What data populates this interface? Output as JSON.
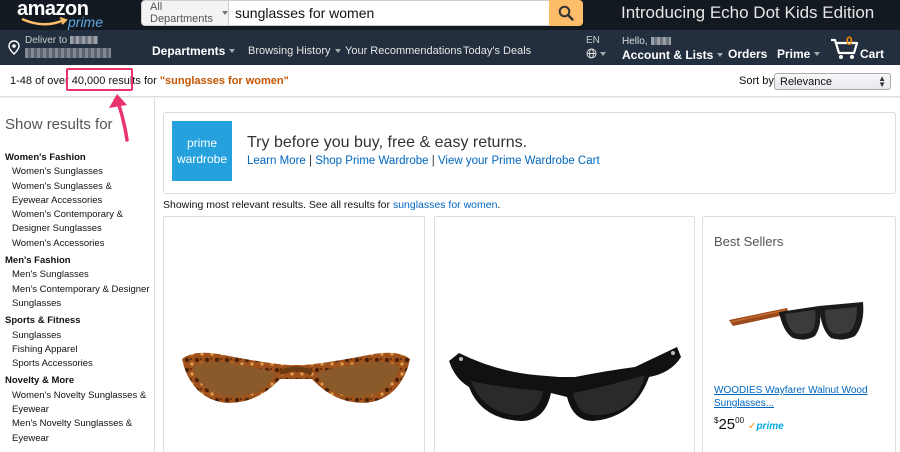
{
  "colors": {
    "nav_top": "#131921",
    "nav_bottom": "#232f3e",
    "search_button": "#febd69",
    "link": "#0066c0",
    "query": "#c45500",
    "annotation": "#e8336d",
    "prime_wardrobe": "#25a2de"
  },
  "header": {
    "logo_text": "amazon",
    "logo_sub": "prime",
    "search": {
      "department": "All Departments",
      "query": "sunglasses for women",
      "button_icon": "search-icon"
    },
    "promo": "Introducing Echo Dot Kids Edition",
    "deliver_label": "Deliver to",
    "nav_links": {
      "departments": "Departments",
      "browsing_history": "Browsing History",
      "recommendations": "Your Recommendations",
      "deals": "Today's Deals"
    },
    "language": "EN",
    "account_hello": "Hello,",
    "account": "Account & Lists",
    "orders": "Orders",
    "prime": "Prime",
    "cart_count": "0",
    "cart": "Cart"
  },
  "results": {
    "prefix": "1-48 of over",
    "count": "40,000 results",
    "for": "for",
    "query": "\"sunglasses for women\"",
    "sort_label": "Sort by",
    "sort_value": "Relevance"
  },
  "sidebar": {
    "title": "Show results for",
    "categories": [
      {
        "name": "Women's Fashion",
        "items": [
          "Women's Sunglasses",
          "Women's Sunglasses & Eyewear Accessories",
          "Women's Contemporary & Designer Sunglasses",
          "Women's Accessories"
        ]
      },
      {
        "name": "Men's Fashion",
        "items": [
          "Men's Sunglasses",
          "Men's Contemporary & Designer Sunglasses"
        ]
      },
      {
        "name": "Sports & Fitness",
        "items": [
          "Sunglasses",
          "Fishing Apparel",
          "Sports Accessories"
        ]
      },
      {
        "name": "Novelty & More",
        "items": [
          "Women's Novelty Sunglasses & Eyewear",
          "Men's Novelty Sunglasses & Eyewear"
        ]
      }
    ]
  },
  "wardrobe": {
    "logo_line1": "prime",
    "logo_line2": "wardrobe",
    "title": "Try before you buy, free & easy returns.",
    "link1": "Learn More",
    "link2": "Shop Prime Wardrobe",
    "link3": "View your Prime Wardrobe Cart",
    "sep": "|"
  },
  "relevant": {
    "text": "Showing most relevant results. See all results for",
    "link": "sunglasses for women",
    "end": "."
  },
  "best_sellers": {
    "title": "Best Sellers",
    "product_name": "WOODIES Wayfarer Walnut Wood Sunglasses...",
    "price_symbol": "$",
    "price_whole": "25",
    "price_fraction": "00",
    "prime": "prime"
  }
}
